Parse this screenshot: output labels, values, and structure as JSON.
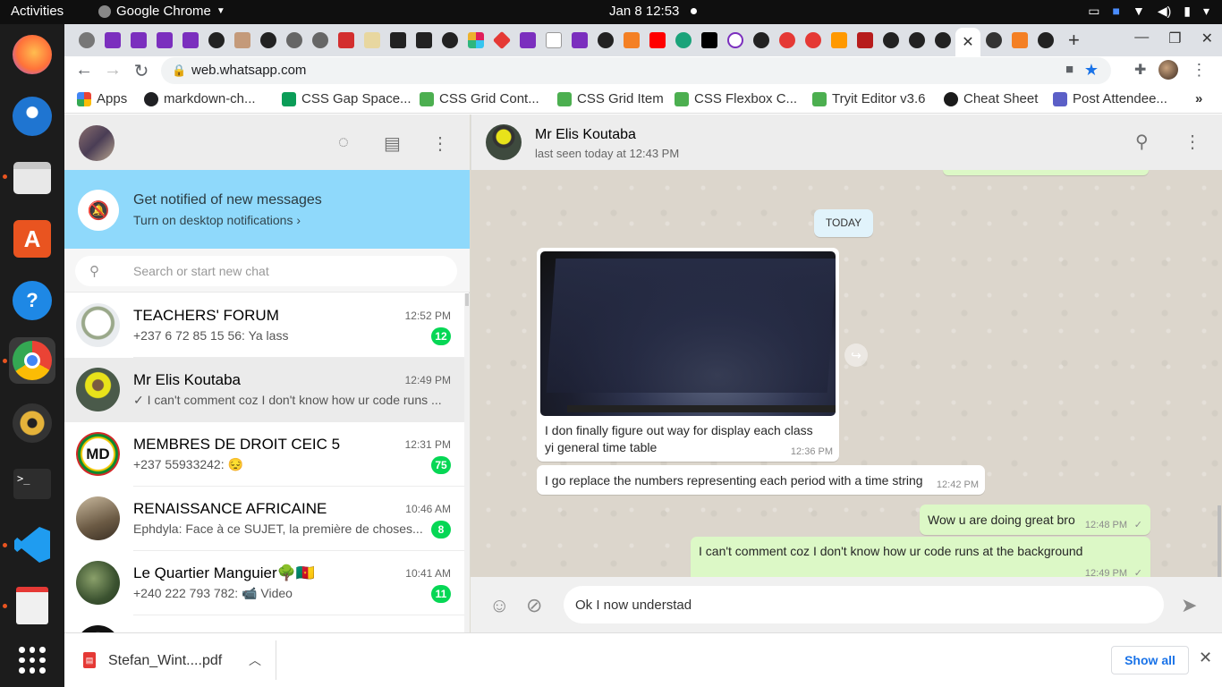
{
  "system": {
    "activities": "Activities",
    "app_menu": "Google Chrome",
    "clock": "Jan 8  12:53"
  },
  "browser": {
    "url": "web.whatsapp.com",
    "bookmarks": [
      {
        "label": "Apps",
        "color": "#d93025"
      },
      {
        "label": "markdown-ch...",
        "color": "#202124"
      },
      {
        "label": "CSS Gap Space...",
        "color": "#0b9d58"
      },
      {
        "label": "CSS Grid Cont...",
        "color": "#4caf50"
      },
      {
        "label": "CSS Grid Item",
        "color": "#4caf50"
      },
      {
        "label": "CSS Flexbox C...",
        "color": "#4caf50"
      },
      {
        "label": "Tryit Editor v3.6",
        "color": "#4caf50"
      },
      {
        "label": "Cheat Sheet",
        "color": "#1b1b1b"
      },
      {
        "label": "Post Attendee...",
        "color": "#5b5fc7"
      }
    ]
  },
  "whatsapp": {
    "notification": {
      "title": "Get notified of new messages",
      "subtitle": "Turn on desktop notifications ›"
    },
    "search": {
      "placeholder": "Search or start new chat"
    },
    "chats": [
      {
        "name": "TEACHERS' FORUM",
        "time": "12:52 PM",
        "last": "+237 6 72 85 15 56: Ya lass",
        "badge": "12",
        "avatar_color": "#cfd8dc"
      },
      {
        "name": "Mr Elis Koutaba",
        "time": "12:49 PM",
        "last": "✓ I can't comment coz I don't know how ur code runs ...",
        "badge": "",
        "avatar_color": "#c6cc2a"
      },
      {
        "name": "MEMBRES DE DROIT CEIC 5",
        "time": "12:31 PM",
        "last": "+237 55933242: 😔",
        "badge": "75",
        "avatar_color": "#f2c500"
      },
      {
        "name": "RENAISSANCE AFRICAINE",
        "time": "10:46 AM",
        "last": "Ephdyla: Face à ce SUJET, la première de choses...",
        "badge": "8",
        "avatar_color": "#8d7a63"
      },
      {
        "name": "Le Quartier Manguier🌳🇨🇲",
        "time": "10:41 AM",
        "last": "+240 222 793 782: 📹 Video",
        "badge": "11",
        "avatar_color": "#4f6b3a"
      }
    ],
    "conversation": {
      "contact_name": "Mr Elis Koutaba",
      "last_seen": "last seen today at 12:43 PM",
      "date_divider": "TODAY",
      "messages": [
        {
          "direction": "in",
          "text_line1": "I don finally figure out  way for display each class",
          "text_line2": "yi general time table",
          "time": "12:36 PM"
        },
        {
          "direction": "in",
          "text": "I go replace the numbers representing each period with a time string",
          "time": "12:42 PM"
        },
        {
          "direction": "out",
          "text": "Wow u are doing great bro",
          "time": "12:48 PM"
        },
        {
          "direction": "out",
          "text": "I can't comment coz I don't know how ur code runs at the background",
          "time": "12:49 PM"
        }
      ],
      "composer_value": "Ok I now understad"
    }
  },
  "downloads": {
    "file": "Stefan_Wint....pdf",
    "show_all": "Show all"
  }
}
